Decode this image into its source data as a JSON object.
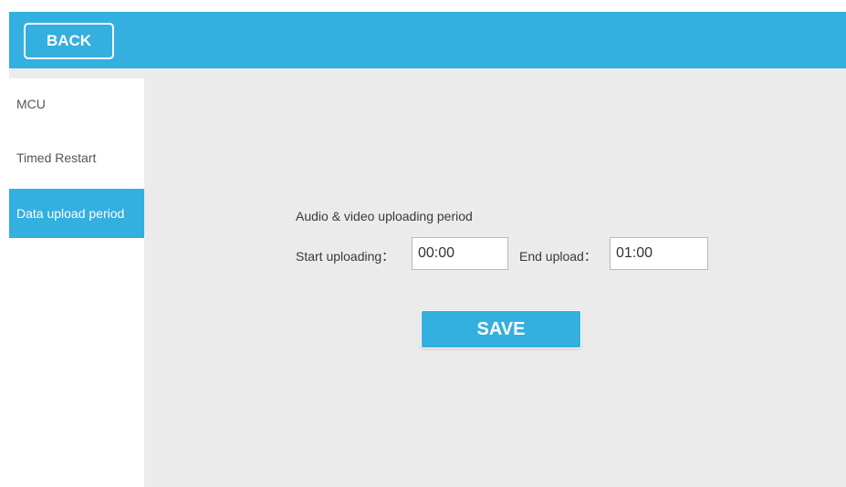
{
  "topbar": {
    "back_label": "BACK"
  },
  "sidebar": {
    "items": [
      {
        "label": "MCU",
        "active": false
      },
      {
        "label": "Timed Restart",
        "active": false
      },
      {
        "label": "Data upload period",
        "active": true
      }
    ]
  },
  "main": {
    "section_title": "Audio & video uploading period",
    "start_label": "Start uploading：",
    "start_value": "00:00",
    "end_label": "End upload：",
    "end_value": "01:00",
    "save_label": "SAVE"
  },
  "colors": {
    "accent": "#33afe0",
    "background": "#ebebeb",
    "panel": "#ffffff"
  }
}
